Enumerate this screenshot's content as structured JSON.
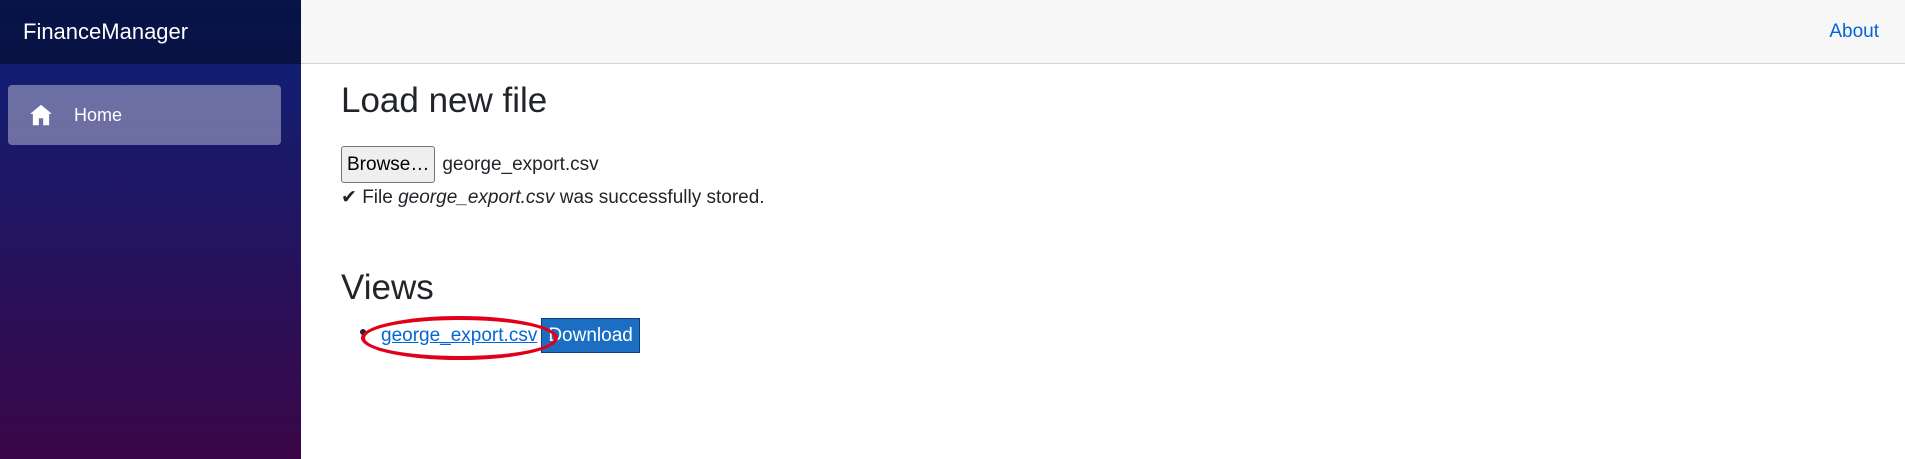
{
  "sidebar": {
    "brand": "FinanceManager",
    "items": [
      {
        "label": "Home",
        "icon": "home-icon",
        "active": true
      }
    ]
  },
  "header": {
    "about_link": "About"
  },
  "upload": {
    "title": "Load new file",
    "browse_label": "Browse…",
    "selected_file": "george_export.csv",
    "status_check": "✔",
    "status_prefix": "File",
    "status_filename": "george_export.csv",
    "status_suffix": "was successfully stored."
  },
  "views": {
    "title": "Views",
    "items": [
      {
        "name": "george_export.csv",
        "download_label": "Download"
      }
    ]
  },
  "colors": {
    "sidebar_top": "#0b2279",
    "sidebar_bottom": "#3a0647",
    "link": "#0366d6",
    "primary_button": "#1b6ec2",
    "annotation_ring": "#e0001a"
  }
}
